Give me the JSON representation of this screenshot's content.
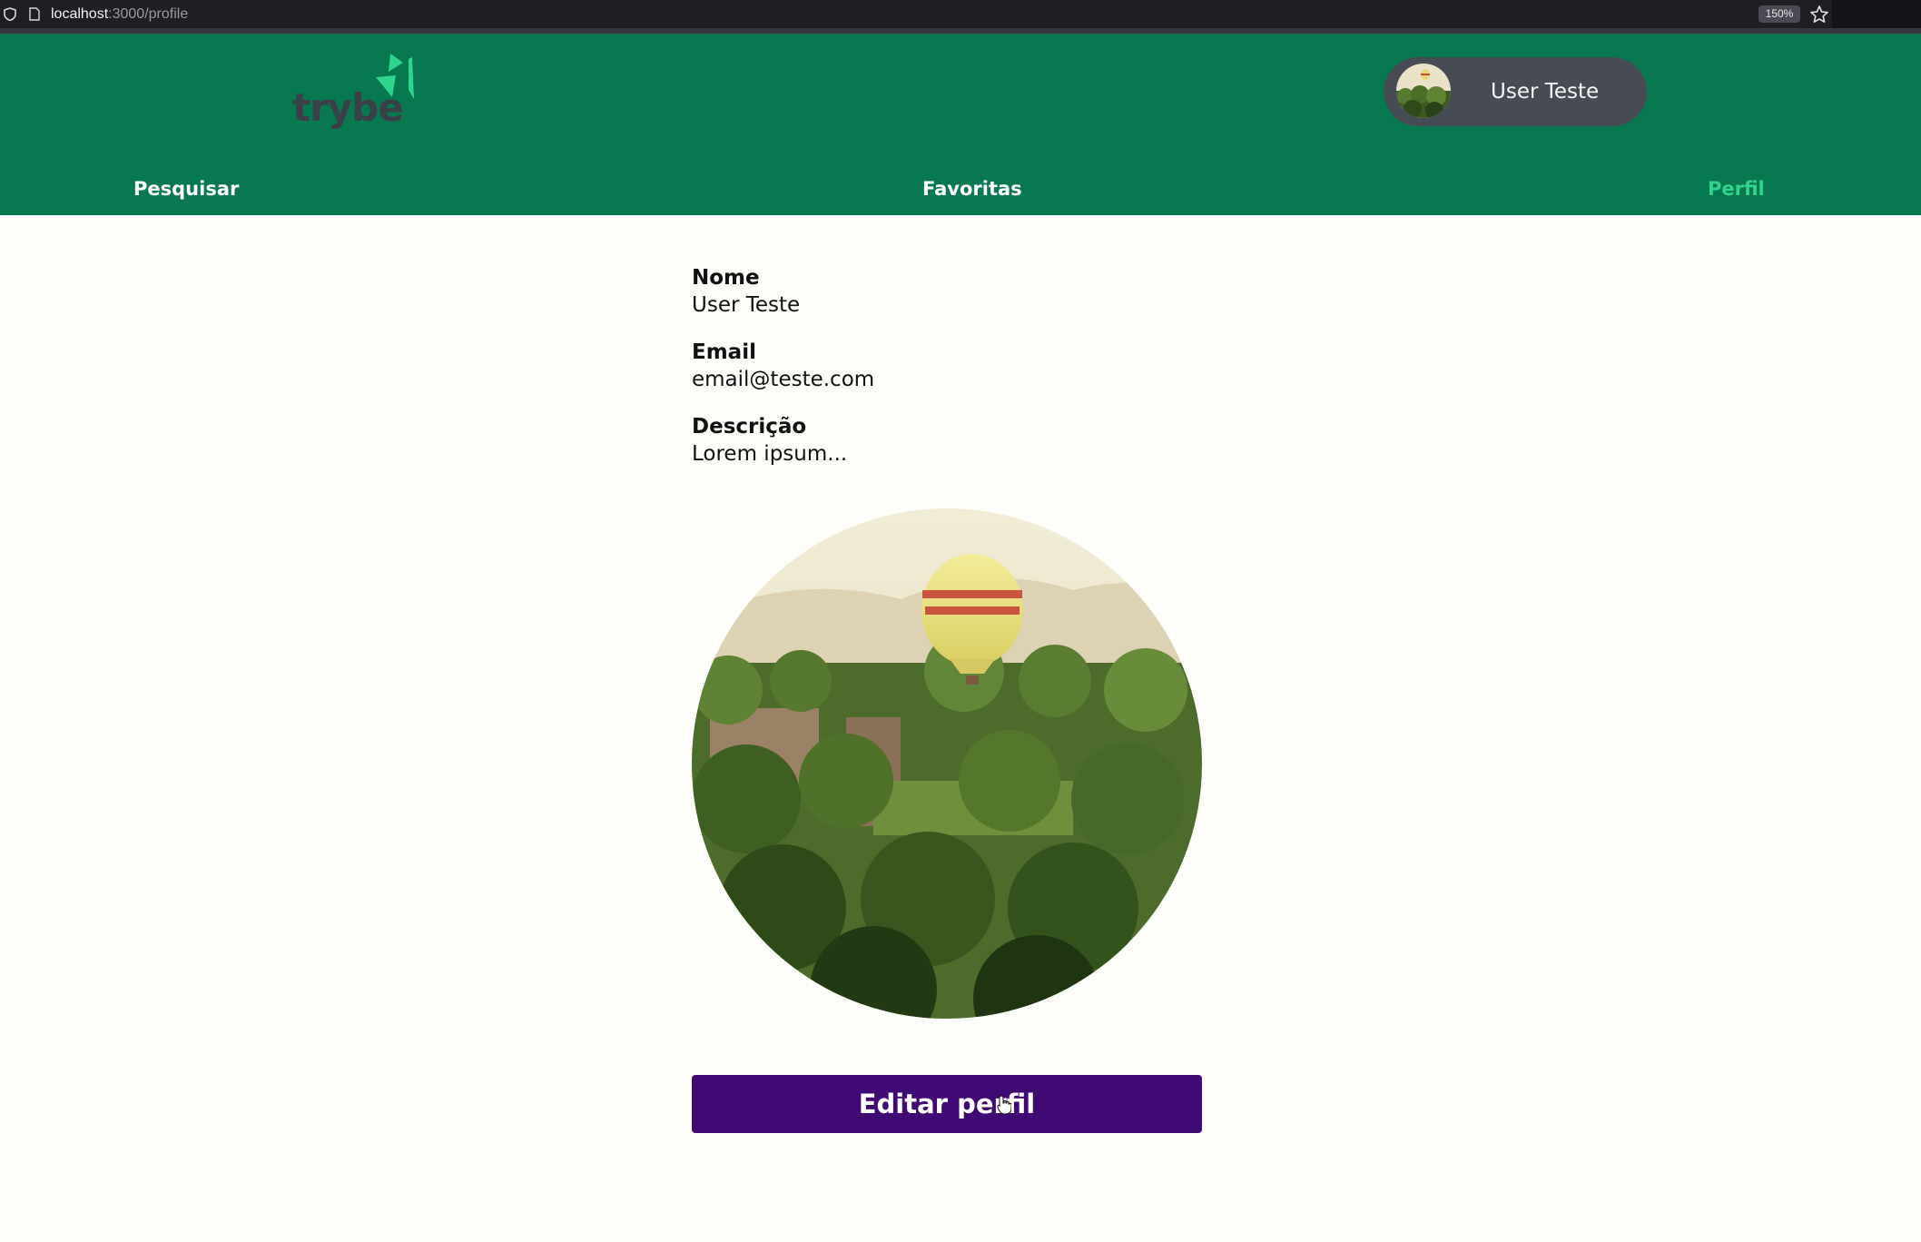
{
  "browser": {
    "url_host": "localhost",
    "url_path": ":3000/profile",
    "zoom": "150%",
    "icons": [
      "shield-icon",
      "page-icon",
      "star-icon"
    ]
  },
  "header": {
    "logo_text": "trybe",
    "user_name": "User Teste",
    "colors": {
      "header_bg": "#077850",
      "accent": "#2fd58c",
      "chip_bg": "#474b54"
    }
  },
  "nav": {
    "search": "Pesquisar",
    "favorites": "Favoritas",
    "profile": "Perfil",
    "active": "profile"
  },
  "profile": {
    "name_label": "Nome",
    "name_value": "User Teste",
    "email_label": "Email",
    "email_value": "email@teste.com",
    "description_label": "Descrição",
    "description_value": "Lorem ipsum...",
    "edit_button": "Editar perfil",
    "button_color": "#3f0a73"
  }
}
